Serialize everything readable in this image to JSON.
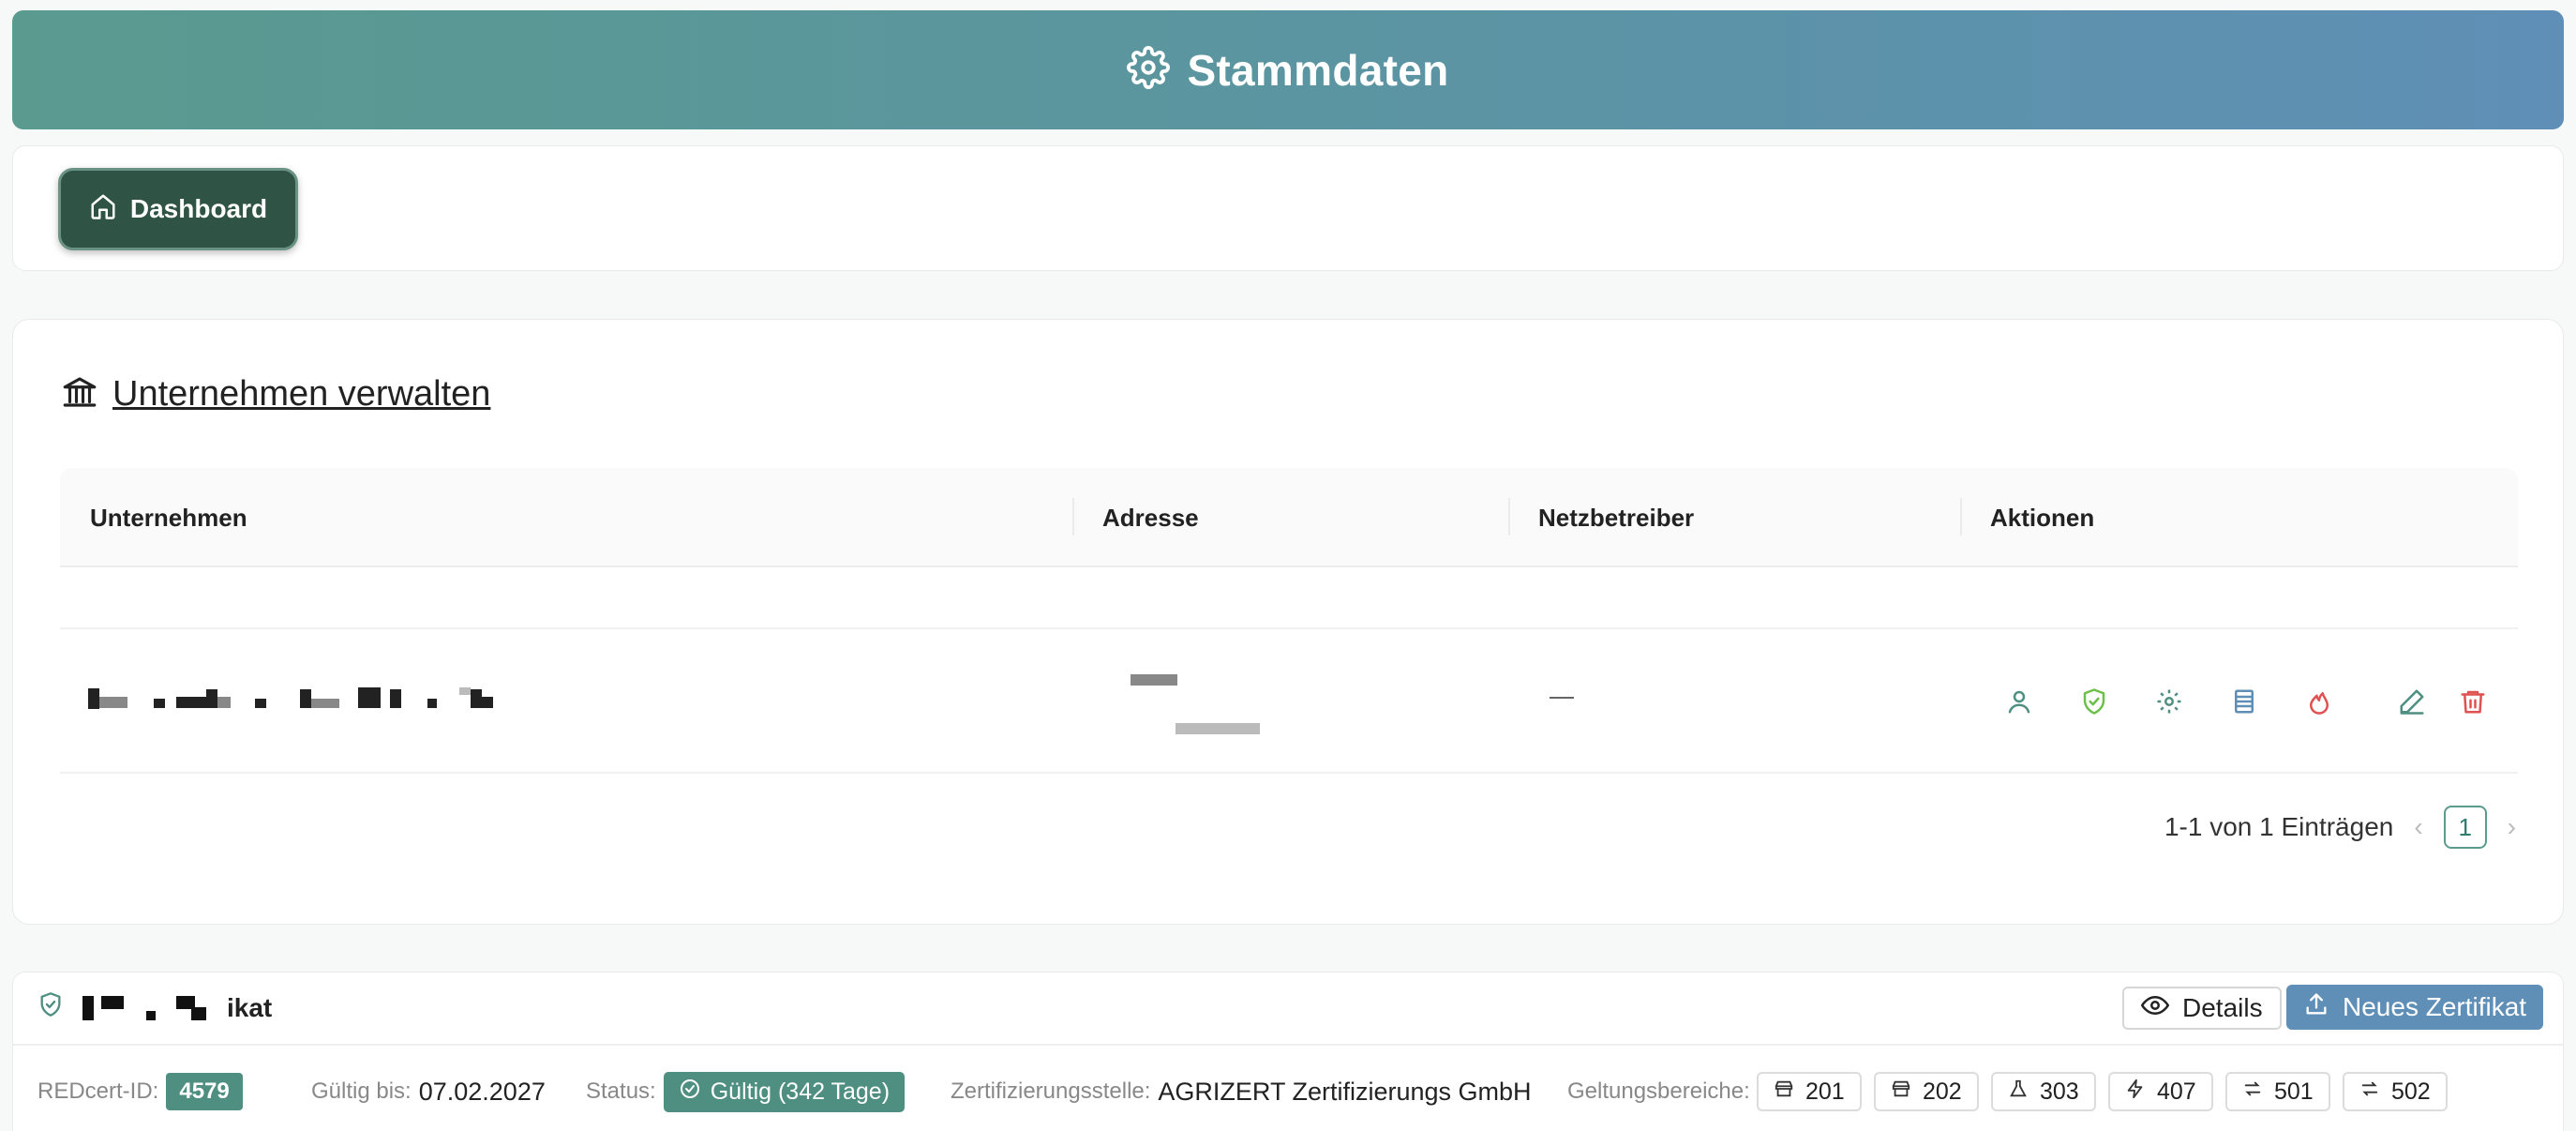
{
  "header": {
    "title": "Stammdaten",
    "icon": "gear-icon"
  },
  "nav": {
    "dashboard_label": "Dashboard",
    "dashboard_icon": "home-icon"
  },
  "companies": {
    "title": "Unternehmen verwalten",
    "icon": "bank-icon",
    "columns": [
      "Unternehmen",
      "Adresse",
      "Netzbetreiber",
      "Aktionen"
    ],
    "rows": [
      {
        "company": "",
        "address": "",
        "network_operator": "—"
      }
    ],
    "actions": [
      "user-icon",
      "shield-check-icon",
      "gear-icon",
      "list-icon",
      "flame-icon",
      "edit-icon",
      "trash-icon"
    ],
    "pagination": {
      "summary": "1-1 von 1 Einträgen",
      "page": "1",
      "prev": "‹",
      "next": "›"
    }
  },
  "certificate": {
    "title_suffix": "ikat",
    "details_label": "Details",
    "new_label": "Neues Zertifikat",
    "redcert_label": "REDcert-ID:",
    "redcert_id": "4579",
    "valid_label": "Gültig bis:",
    "valid_until": "07.02.2027",
    "status_label": "Status:",
    "status_value": "Gültig (342 Tage)",
    "body_label": "Zertifizierungsstelle:",
    "body_value": "AGRIZERT Zertifizierungs GmbH",
    "scopes_label": "Geltungsbereiche:",
    "scopes": [
      {
        "code": "201",
        "icon": "store-icon"
      },
      {
        "code": "202",
        "icon": "store-icon"
      },
      {
        "code": "303",
        "icon": "flask-icon"
      },
      {
        "code": "407",
        "icon": "bolt-icon"
      },
      {
        "code": "501",
        "icon": "arrows-icon"
      },
      {
        "code": "502",
        "icon": "arrows-icon"
      }
    ]
  },
  "colors": {
    "accent": "#5a9a8f",
    "dark": "#2f5446",
    "blue": "#5f8fb6",
    "danger": "#e05252"
  }
}
